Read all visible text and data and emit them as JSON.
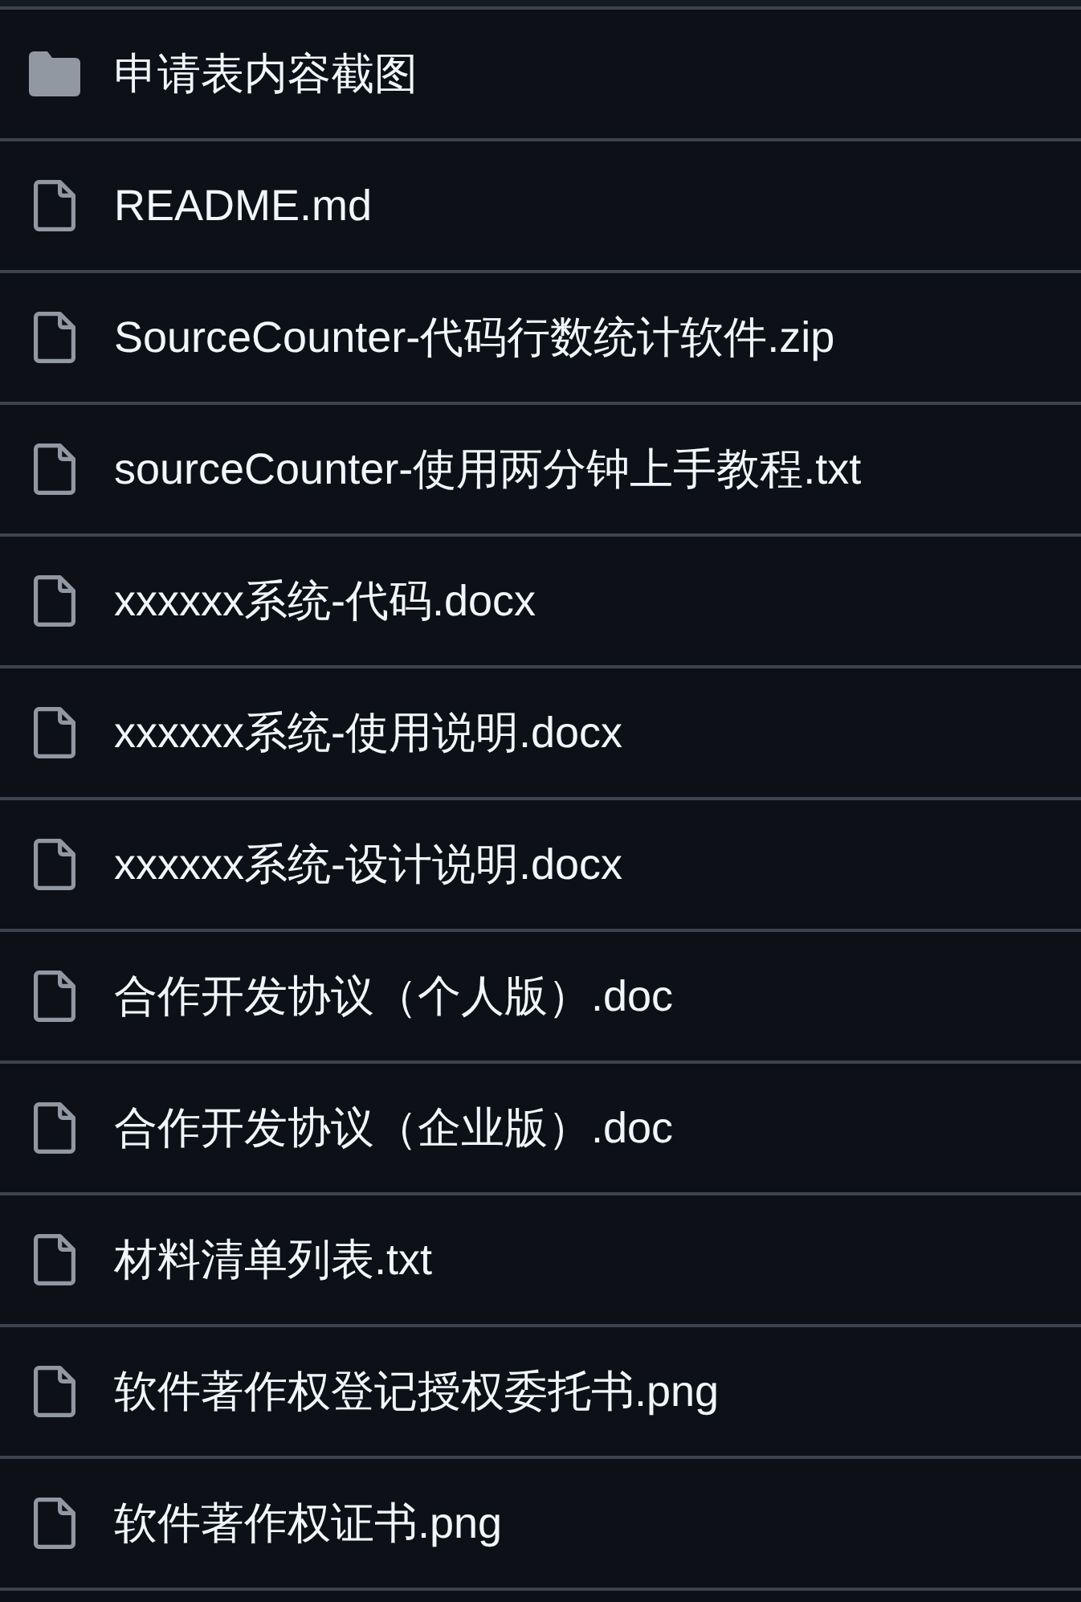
{
  "files": [
    {
      "kind": "folder",
      "name": "申请表内容截图"
    },
    {
      "kind": "file",
      "name": "README.md"
    },
    {
      "kind": "file",
      "name": "SourceCounter-代码行数统计软件.zip"
    },
    {
      "kind": "file",
      "name": "sourceCounter-使用两分钟上手教程.txt"
    },
    {
      "kind": "file",
      "name": "xxxxxx系统-代码.docx"
    },
    {
      "kind": "file",
      "name": "xxxxxx系统-使用说明.docx"
    },
    {
      "kind": "file",
      "name": "xxxxxx系统-设计说明.docx"
    },
    {
      "kind": "file",
      "name": "合作开发协议（个人版）.doc"
    },
    {
      "kind": "file",
      "name": "合作开发协议（企业版）.doc"
    },
    {
      "kind": "file",
      "name": "材料清单列表.txt"
    },
    {
      "kind": "file",
      "name": "软件著作权登记授权委托书.png"
    },
    {
      "kind": "file",
      "name": "软件著作权证书.png"
    }
  ]
}
